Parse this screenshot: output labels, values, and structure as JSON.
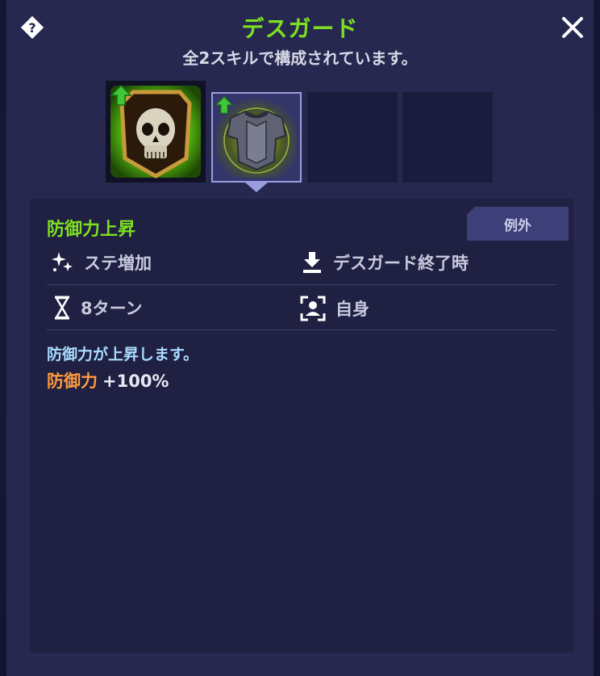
{
  "header": {
    "title": "デスガード",
    "subtitle": "全2スキルで構成されています。"
  },
  "skills": [
    {
      "icon": "skull-shield-icon",
      "buff": "up-arrow-icon"
    },
    {
      "icon": "armor-icon",
      "buff": "up-arrow-icon",
      "selected": true
    },
    {
      "icon": "empty-slot"
    },
    {
      "icon": "empty-slot"
    }
  ],
  "detail": {
    "exception_tab": "例外",
    "skill_name": "防御力上昇",
    "effect_type": "ステ増加",
    "timing": "デスガード終了時",
    "duration": "8ターン",
    "target": "自身",
    "description": "防御力が上昇します。",
    "effect_label": "防御力",
    "effect_value": "+100%"
  },
  "colors": {
    "title_green": "#7ee020",
    "description_blue": "#a9dcff",
    "effect_orange": "#ff9a3c",
    "panel_bg": "#262850"
  }
}
